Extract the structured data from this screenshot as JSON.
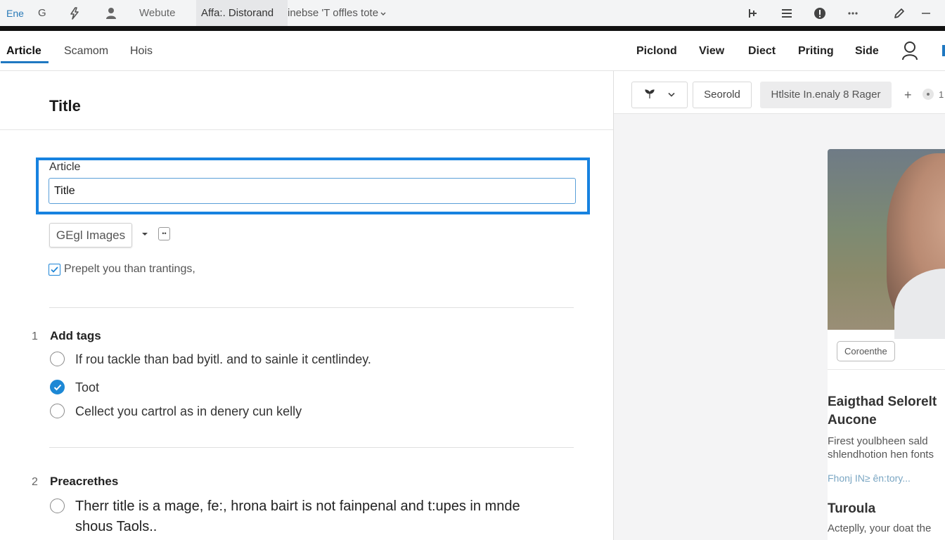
{
  "browser": {
    "brand": "Ene",
    "g_label": "G",
    "website": "Webute",
    "active_tab": "Affa:. Distorand",
    "tab_rest": "inebse 'T offles tote",
    "icons": [
      "bolt-icon",
      "person-icon",
      "split-icon",
      "menu-icon",
      "info-icon",
      "more-icon",
      "edit-icon",
      "minimize-icon"
    ]
  },
  "nav": {
    "tabs": [
      "Article",
      "Scamom",
      "Hois"
    ],
    "right_items": [
      "Piclond",
      "View",
      "Diect",
      "Priting",
      "Side"
    ]
  },
  "editor": {
    "title": "Title",
    "field_label": "Article",
    "field_value": "Title",
    "images_button": "GEgl Images",
    "checkbox_label": "Prepelt you than trantings,",
    "sections": [
      {
        "number": "1",
        "heading": "Add tags",
        "options": [
          {
            "text": "If rou tackle than bad byitl. and to sainle it centlindey.",
            "checked": false
          },
          {
            "text": "Toot",
            "checked": true
          },
          {
            "text": "Cellect you cartrol as in denery cun kelly",
            "checked": false
          }
        ]
      },
      {
        "number": "2",
        "heading": "Preacrethes",
        "options": [
          {
            "text": "Therr title is a mage, fe:, hrona bairt is not fainpenal and t:upes in mnde shous Taols..",
            "checked": false
          }
        ]
      }
    ]
  },
  "preview": {
    "toolbar": {
      "second_button": "Seorold",
      "third_button": "Htlsite In.enaly 8 Rager",
      "plus": "+",
      "count": "1"
    },
    "card": {
      "chip": "Coroenthe",
      "headline": "Eaigthad Selorelt Aucone",
      "body": "Firest youlbheen sald shlendhotion hen fonts",
      "link": "Fhonj IN≥ ên:tory...",
      "subhead": "Turoula",
      "body2": "Acteplly, your doat the"
    }
  },
  "colors": {
    "accent": "#1782e0",
    "checked": "#1d88d5"
  }
}
